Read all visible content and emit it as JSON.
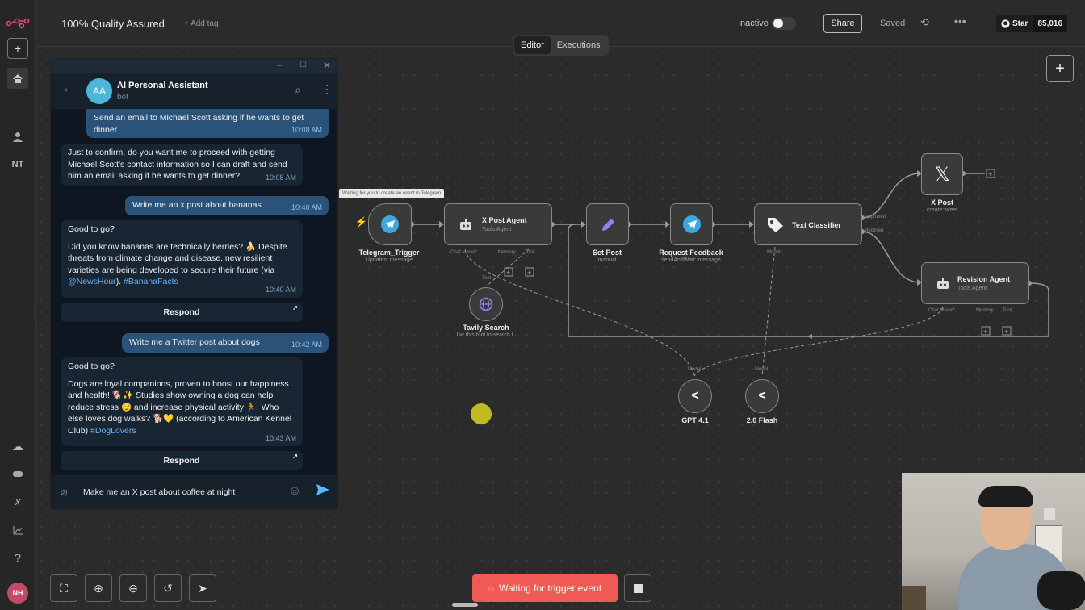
{
  "app": {
    "workflow_title": "100% Quality Assured",
    "add_tag": "+ Add tag",
    "status_label": "Inactive",
    "share_label": "Share",
    "saved_label": "Saved",
    "github_star": "Star",
    "github_count": "85,016",
    "user_initials": "NH",
    "sidebar_nt": "NT"
  },
  "tabs": [
    {
      "label": "Editor",
      "active": true
    },
    {
      "label": "Executions",
      "active": false
    }
  ],
  "nodes": {
    "telegram_trigger": {
      "title": "Telegram_Trigger",
      "sub": "Updates: message"
    },
    "x_post_agent": {
      "title": "X Post Agent",
      "sub": "Tools Agent",
      "ports": [
        "Chat Model*",
        "Memory",
        "Tool"
      ]
    },
    "set_post": {
      "title": "Set Post",
      "sub": "manual"
    },
    "request_feedback": {
      "title": "Request Feedback",
      "sub": "sendAndWait: message"
    },
    "text_classifier": {
      "title": "Text Classifier",
      "outputs": [
        "approved",
        "declined"
      ],
      "port": "Model*"
    },
    "x_post": {
      "title": "X Post",
      "sub": "create:tweet"
    },
    "revision_agent": {
      "title": "Revision Agent",
      "sub": "Tools Agent",
      "ports": [
        "Chat Model*",
        "Memory",
        "Tool"
      ]
    },
    "tavily": {
      "title": "Tavily Search",
      "sub": "Use this tool to search t...",
      "port": "Tool"
    },
    "gpt41": {
      "title": "GPT 4.1",
      "port": "Model"
    },
    "flash": {
      "title": "2.0 Flash",
      "port": "Model"
    }
  },
  "tooltip": "Waiting for you to create an event in Telegram",
  "trigger_button": "Waiting for trigger event",
  "chat": {
    "name": "AI Personal Assistant",
    "status": "bot",
    "avatar": "AA",
    "input_text": "Make me an X post about coffee at night",
    "messages": [
      {
        "dir": "out",
        "text": "Send an email to Michael Scott asking if he wants to get dinner",
        "time": "10:08 AM"
      },
      {
        "dir": "in",
        "text": "Just to confirm, do you want me to proceed with getting Michael Scott's contact information so I can draft and send him an email asking if he wants to get dinner?",
        "time": "10:08 AM"
      },
      {
        "dir": "out",
        "text": "Write me an x post about bananas",
        "time": "10:40 AM"
      },
      {
        "dir": "in",
        "line1": "Good to go?",
        "line2": "Did you know bananas are technically berries? 🍌 Despite threats from climate change and disease, new resilient varieties are being developed to secure their future (via ",
        "link1": "@NewsHour",
        "mid": "). ",
        "link2": "#BananaFacts",
        "time": "10:40 AM",
        "button": "Respond"
      },
      {
        "dir": "out",
        "text": "Write me a Twitter post about dogs",
        "time": "10:42 AM"
      },
      {
        "dir": "in",
        "line1": "Good to go?",
        "line2": "Dogs are loyal companions, proven to boost our happiness and health! 🐕✨ Studies show owning a dog can help reduce stress 😌 and increase physical activity 🏃. Who else loves dog walks? 🐕💛 (according to American Kennel Club) ",
        "link1": "#DogLovers",
        "time": "10:43 AM",
        "button": "Respond"
      }
    ]
  }
}
